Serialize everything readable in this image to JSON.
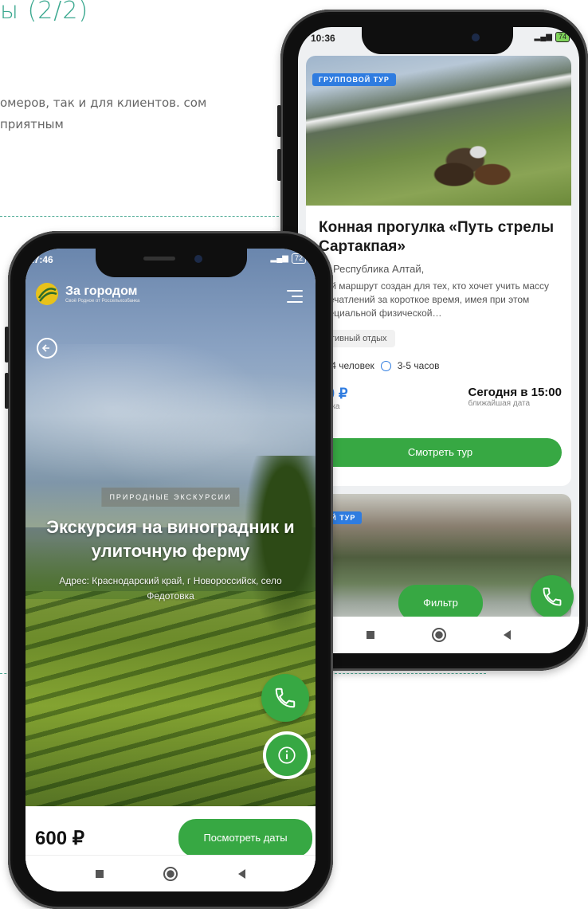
{
  "slide": {
    "title": "ы (2/2)",
    "body": "омеров, так и для клиентов. сом приятным"
  },
  "back_phone": {
    "status": {
      "time": "10:36",
      "battery": "74"
    },
    "card1": {
      "badge": "ГРУППОВОЙ ТУР",
      "title": "Конная прогулка «Путь стрелы Сартакпая»",
      "location": "Республика Алтай,",
      "description": "ный маршрут создан для тех, кто хочет учить массу впечатлений за короткое время, имея при этом специальной физической…",
      "tag": "ктивный отдых",
      "group": "от 4 человек",
      "duration": "3-5 часов",
      "price": "00 ₽",
      "price_sub": "овека",
      "date": "Сегодня в 15:00",
      "date_sub": "ближайшая дата",
      "cta": "Смотреть тур"
    },
    "card2": {
      "badge": "ОВОЙ ТУР"
    },
    "filter_button": "Фильтр",
    "icons": {
      "call": "phone-icon",
      "clock": "clock-icon",
      "location": "location-pin-icon"
    },
    "colors": {
      "accent": "#37a843",
      "badge": "#2f7ce0"
    }
  },
  "front_phone": {
    "status": {
      "time": "17:46",
      "battery": "72"
    },
    "brand": {
      "name": "За городом",
      "tagline": "Своё Родное от Россельхозбанка"
    },
    "eyebrow": "ПРИРОДНЫЕ ЭКСКУРСИИ",
    "title": "Экскурсия на виноградник и улиточную ферму",
    "address": "Адрес: Краснодарский край, г Новороссийск, село Федотовка",
    "price": "600 ₽",
    "cta": "Посмотреть даты",
    "icons": {
      "menu": "hamburger-menu-icon",
      "back": "back-arrow-icon",
      "call": "phone-icon",
      "info": "info-icon"
    }
  }
}
